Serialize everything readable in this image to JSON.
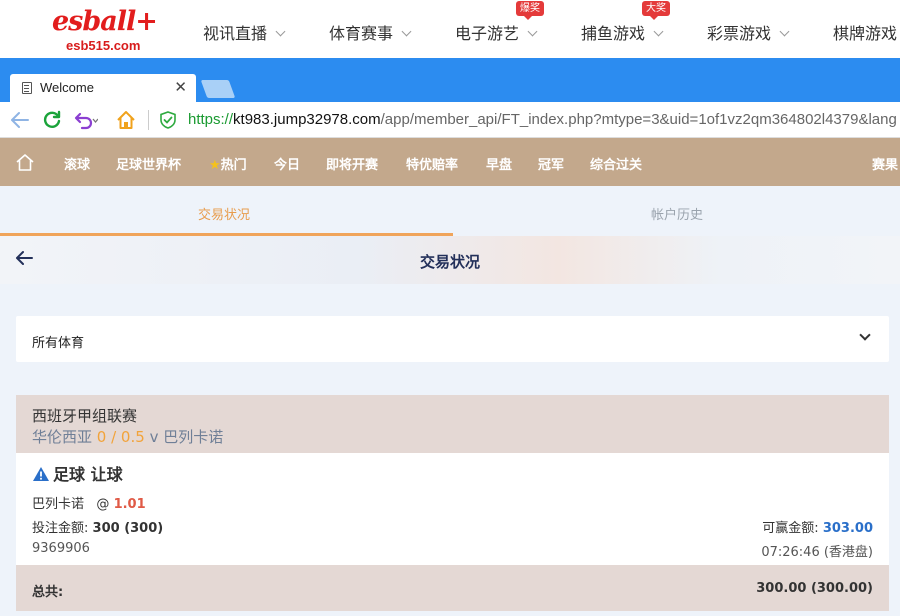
{
  "site": {
    "logo_brand": "esball+",
    "logo_domain": "esb515.com",
    "nav": [
      {
        "label": "视讯直播"
      },
      {
        "label": "体育赛事"
      },
      {
        "label": "电子游艺",
        "badge": "爆奖"
      },
      {
        "label": "捕鱼游戏",
        "badge": "大奖"
      },
      {
        "label": "彩票游戏"
      },
      {
        "label": "棋牌游戏"
      }
    ]
  },
  "browser": {
    "tab_title": "Welcome",
    "url_scheme": "https://",
    "url_host": "kt983.jump32978.com",
    "url_path": "/app/member_api/FT_index.php?mtype=3&uid=1of1vz2qm364802l4379&lang"
  },
  "menu": {
    "items": [
      "滚球",
      "足球世界杯",
      "热门",
      "今日",
      "即将开赛",
      "特优赔率",
      "早盘",
      "冠军",
      "综合过关",
      "赛果"
    ]
  },
  "tabs": {
    "active": "交易状况",
    "inactive": "帐户历史"
  },
  "page": {
    "title": "交易状况"
  },
  "filter": {
    "selected": "所有体育"
  },
  "bet": {
    "league": "西班牙甲组联赛",
    "home": "华伦西亚",
    "handicap": "0 / 0.5",
    "vs": "v",
    "away": "巴列卡诺",
    "type": "足球 让球",
    "selection": "巴列卡诺",
    "at": "@",
    "odds": "1.01",
    "stake_label": "投注金额:",
    "stake_value": "300 (300)",
    "win_label": "可赢金额:",
    "win_value": "303.00",
    "ticket_id": "9369906",
    "time": "07:26:46 (香港盘)"
  },
  "summary": {
    "label": "总共:",
    "value": "300.00 (300.00)"
  },
  "colors": {
    "accent": "#f0a45a",
    "menu_bg": "#c3a88c",
    "chrome_blue": "#2c8cf0",
    "brand_red": "#e21d1d"
  },
  "icons": [
    "home-icon",
    "star-icon",
    "back-arrow-icon",
    "chevron-down-icon",
    "warning-icon",
    "refresh-icon",
    "undo-icon",
    "shield-icon",
    "document-icon",
    "close-icon"
  ]
}
